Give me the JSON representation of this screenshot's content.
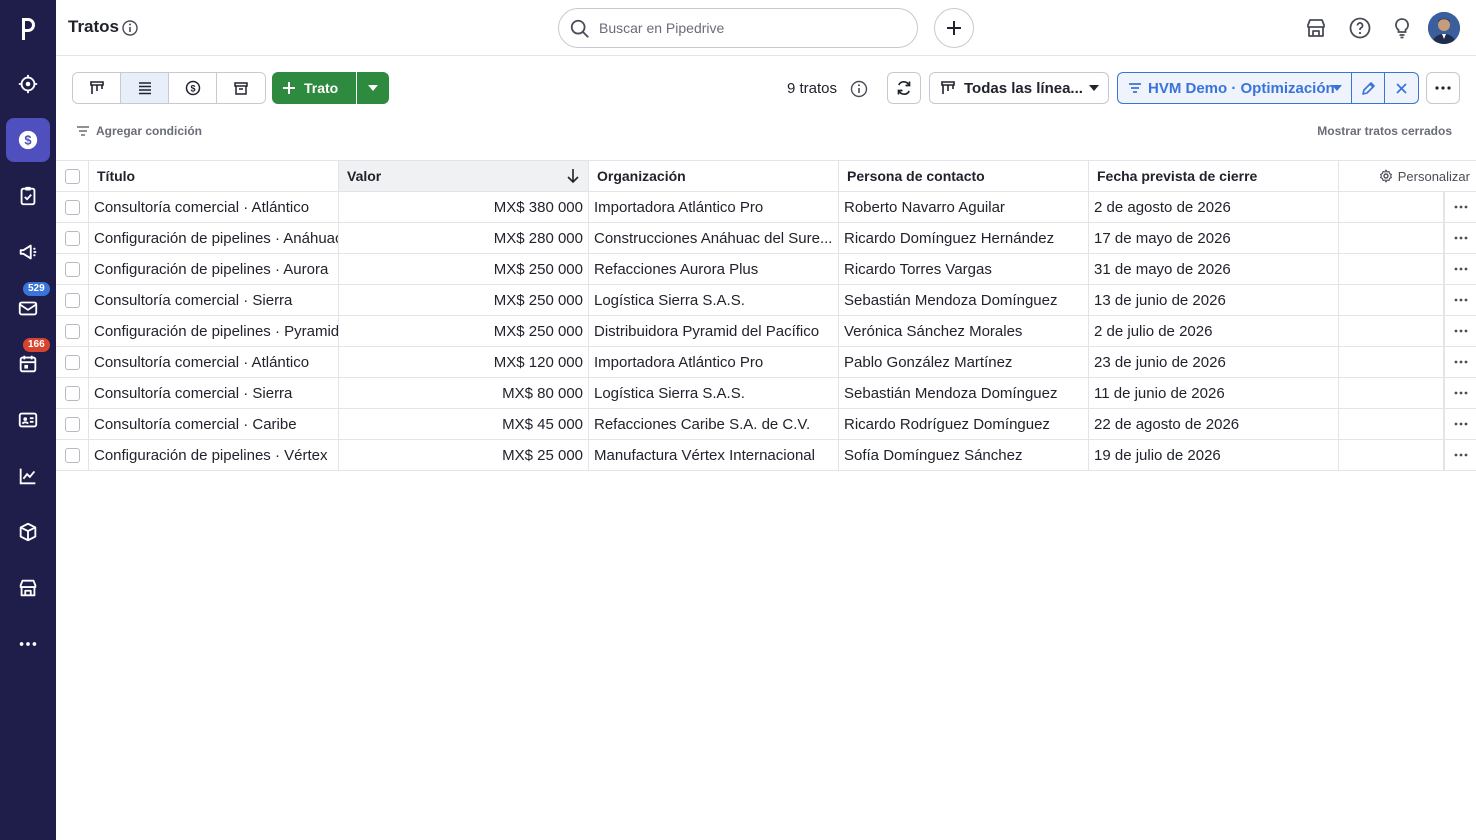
{
  "sidebar": {
    "logo": "p",
    "badges": {
      "mail": "529",
      "activities": "166"
    },
    "items": [
      "target-icon",
      "deals-icon",
      "projects-icon",
      "campaigns-icon",
      "mail-icon",
      "calendar-icon",
      "contacts-icon",
      "insights-icon",
      "products-icon",
      "marketplace-icon",
      "more-icon"
    ]
  },
  "header": {
    "title": "Tratos",
    "search_placeholder": "Buscar en Pipedrive"
  },
  "toolbar": {
    "add_deal_label": "Trato",
    "deal_count": "9 tratos",
    "pipeline": "Todas las línea...",
    "filter": "HVM Demo · Optimización",
    "add_condition": "Agregar condición",
    "show_closed": "Mostrar tratos cerrados"
  },
  "table": {
    "columns": {
      "title": "Título",
      "value": "Valor",
      "org": "Organización",
      "person": "Persona de contacto",
      "date": "Fecha prevista de cierre",
      "customize": "Personalizar"
    },
    "rows": [
      {
        "title": "Consultoría comercial · Atlántico",
        "value": "MX$ 380 000",
        "org": "Importadora Atlántico Pro",
        "person": "Roberto Navarro Aguilar",
        "date": "2 de agosto de 2026"
      },
      {
        "title": "Configuración de pipelines · Anáhuac",
        "value": "MX$ 280 000",
        "org": "Construcciones Anáhuac del Sure...",
        "person": "Ricardo Domínguez Hernández",
        "date": "17 de mayo de 2026"
      },
      {
        "title": "Configuración de pipelines · Aurora",
        "value": "MX$ 250 000",
        "org": "Refacciones Aurora Plus",
        "person": "Ricardo Torres Vargas",
        "date": "31 de mayo de 2026"
      },
      {
        "title": "Consultoría comercial · Sierra",
        "value": "MX$ 250 000",
        "org": "Logística Sierra S.A.S.",
        "person": "Sebastián Mendoza Domínguez",
        "date": "13 de junio de 2026"
      },
      {
        "title": "Configuración de pipelines · Pyramid",
        "value": "MX$ 250 000",
        "org": "Distribuidora Pyramid del Pacífico",
        "person": "Verónica Sánchez Morales",
        "date": "2 de julio de 2026"
      },
      {
        "title": "Consultoría comercial · Atlántico",
        "value": "MX$ 120 000",
        "org": "Importadora Atlántico Pro",
        "person": "Pablo González Martínez",
        "date": "23 de junio de 2026"
      },
      {
        "title": "Consultoría comercial · Sierra",
        "value": "MX$ 80 000",
        "org": "Logística Sierra S.A.S.",
        "person": "Sebastián Mendoza Domínguez",
        "date": "11 de junio de 2026"
      },
      {
        "title": "Consultoría comercial · Caribe",
        "value": "MX$ 45 000",
        "org": "Refacciones Caribe S.A. de C.V.",
        "person": "Ricardo Rodríguez Domínguez",
        "date": "22 de agosto de 2026"
      },
      {
        "title": "Configuración de pipelines · Vértex",
        "value": "MX$ 25 000",
        "org": "Manufactura Vértex Internacional",
        "person": "Sofía Domínguez Sánchez",
        "date": "19 de julio de 2026"
      }
    ]
  },
  "colors": {
    "sidebar": "#1f1e4b",
    "active_nav": "#4f4fbd",
    "primary_green": "#2d8a3e",
    "filter_blue": "#3a73d9"
  }
}
